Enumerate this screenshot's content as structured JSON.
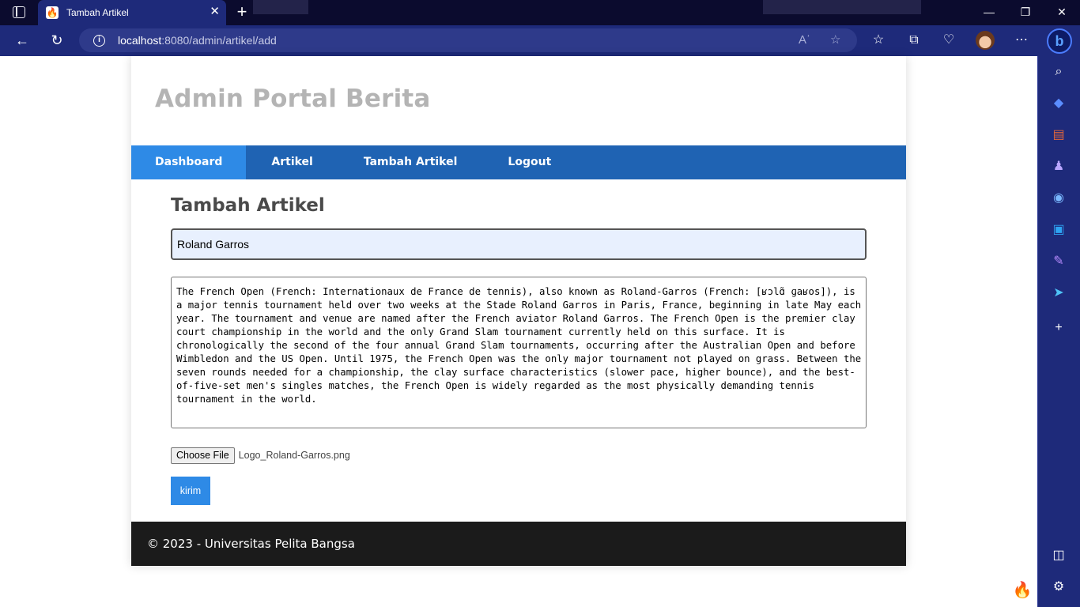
{
  "browser": {
    "tab": {
      "title": "Tambah Artikel",
      "favicon": "codeigniter-flame-icon"
    },
    "address": {
      "host": "localhost",
      "path": ":8080/admin/artikel/add"
    },
    "icons": [
      "back-icon",
      "refresh-icon",
      "info-icon",
      "read-aloud-icon",
      "favorite-star-icon",
      "favorites-icon",
      "collections-icon",
      "browser-essentials-icon",
      "profile-avatar",
      "more-icon",
      "bing-copilot-icon"
    ],
    "sidebar_icons": [
      "search-icon",
      "shopping-tag-icon",
      "tools-briefcase-icon",
      "games-icon",
      "copilot-icon",
      "outlook-icon",
      "notes-icon",
      "send-icon",
      "add-icon",
      "split-screen-icon",
      "settings-icon"
    ]
  },
  "site": {
    "title": "Admin Portal Berita",
    "nav": [
      "Dashboard",
      "Artikel",
      "Tambah Artikel",
      "Logout"
    ],
    "active_nav": "Dashboard"
  },
  "form": {
    "heading": "Tambah Artikel",
    "title_value": "Roland Garros",
    "body_value": "The French Open (French: Internationaux de France de tennis), also known as Roland-Garros (French: [ʁɔlɑ̃ ɡaʁos]), is a major tennis tournament held over two weeks at the Stade Roland Garros in Paris, France, beginning in late May each year. The tournament and venue are named after the French aviator Roland Garros. The French Open is the premier clay court championship in the world and the only Grand Slam tournament currently held on this surface. It is chronologically the second of the four annual Grand Slam tournaments, occurring after the Australian Open and before Wimbledon and the US Open. Until 1975, the French Open was the only major tournament not played on grass. Between the seven rounds needed for a championship, the clay surface characteristics (slower pace, higher bounce), and the best-of-five-set men's singles matches, the French Open is widely regarded as the most physically demanding tennis tournament in the world.",
    "file_button": "Choose File",
    "file_name": "Logo_Roland-Garros.png",
    "submit": "kirim"
  },
  "footer": {
    "text": "© 2023 - Universitas Pelita Bangsa"
  }
}
